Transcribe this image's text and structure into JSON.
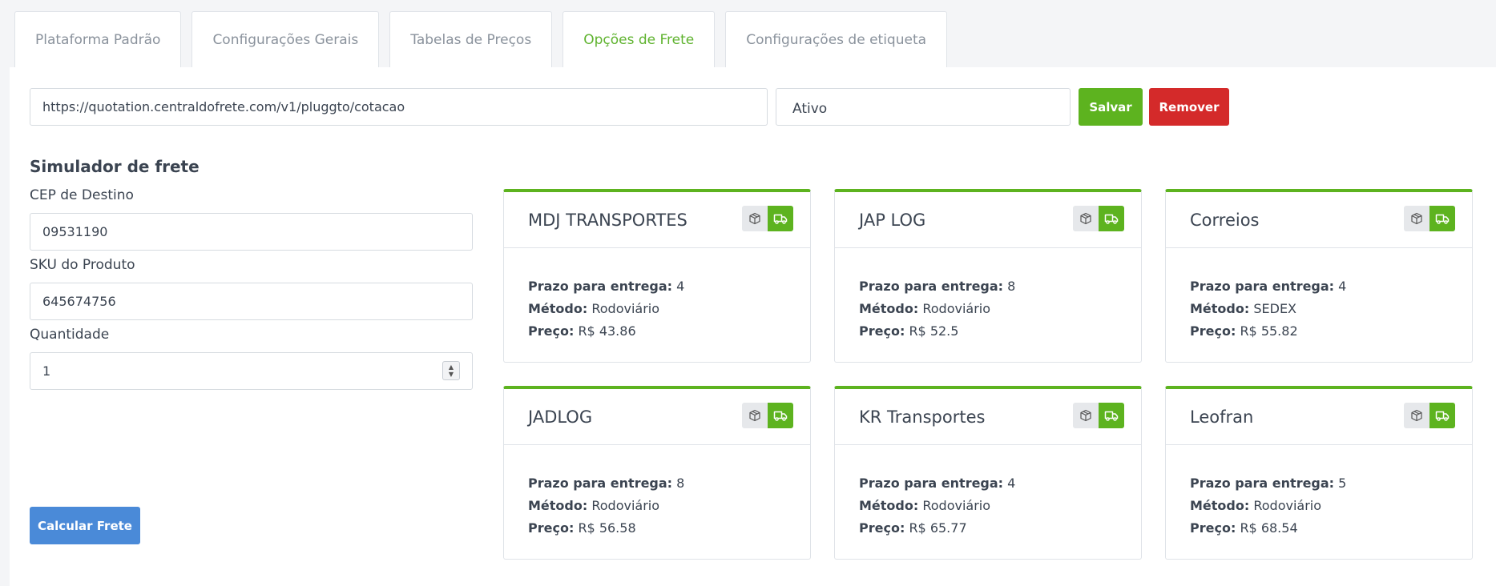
{
  "tabs": [
    {
      "label": "Plataforma Padrão",
      "active": false
    },
    {
      "label": "Configurações Gerais",
      "active": false
    },
    {
      "label": "Tabelas de Preços",
      "active": false
    },
    {
      "label": "Opções de Frete",
      "active": true
    },
    {
      "label": "Configurações de etiqueta",
      "active": false
    }
  ],
  "toolbar": {
    "url_value": "https://quotation.centraldofrete.com/v1/pluggto/cotacao",
    "status_value": "Ativo",
    "save_label": "Salvar",
    "remove_label": "Remover"
  },
  "simulator": {
    "title": "Simulador de frete",
    "cep_label": "CEP de Destino",
    "cep_value": "09531190",
    "sku_label": "SKU do Produto",
    "sku_value": "645674756",
    "qty_label": "Quantidade",
    "qty_value": "1",
    "calc_label": "Calcular Frete"
  },
  "labels": {
    "prazo": "Prazo para entrega:",
    "metodo": "Método:",
    "preco": "Preço:"
  },
  "carriers": [
    {
      "name": "MDJ TRANSPORTES",
      "prazo": "4",
      "metodo": "Rodoviário",
      "preco": "R$ 43.86"
    },
    {
      "name": "JAP LOG",
      "prazo": "8",
      "metodo": "Rodoviário",
      "preco": "R$ 52.5"
    },
    {
      "name": "Correios",
      "prazo": "4",
      "metodo": "SEDEX",
      "preco": "R$ 55.82"
    },
    {
      "name": "JADLOG",
      "prazo": "8",
      "metodo": "Rodoviário",
      "preco": "R$ 56.58"
    },
    {
      "name": "KR Transportes",
      "prazo": "4",
      "metodo": "Rodoviário",
      "preco": "R$ 65.77"
    },
    {
      "name": "Leofran",
      "prazo": "5",
      "metodo": "Rodoviário",
      "preco": "R$ 68.54"
    }
  ],
  "icons": {
    "box": "package-icon",
    "truck": "truck-icon"
  },
  "colors": {
    "accent": "#5db31f",
    "danger": "#d42a2a",
    "primary": "#4a8ad8"
  }
}
